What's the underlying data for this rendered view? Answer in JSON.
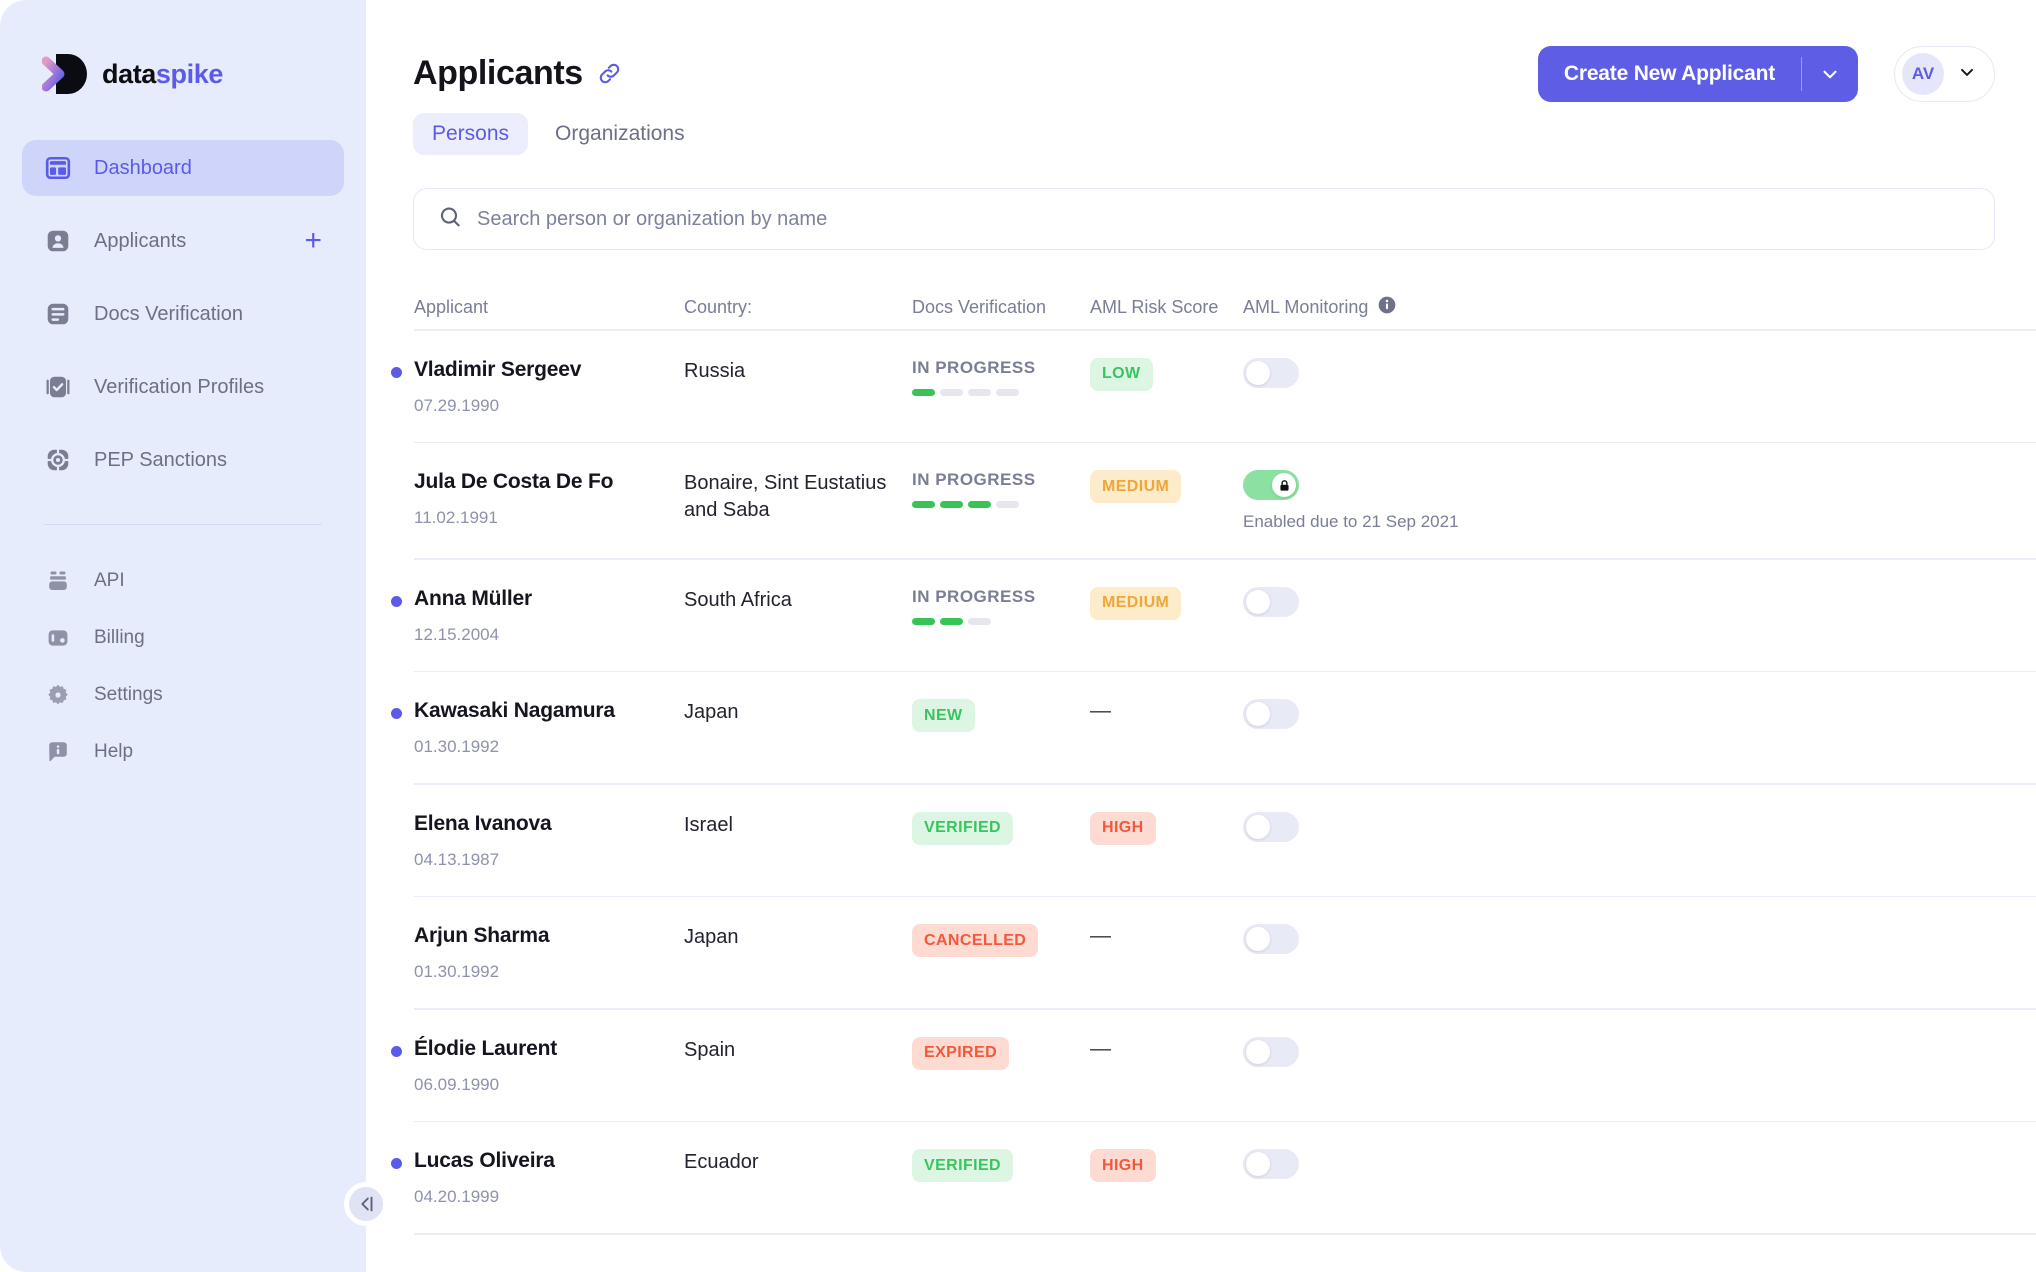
{
  "brand": {
    "name_part1": "data",
    "name_part2": "spike"
  },
  "sidebar": {
    "primary": [
      {
        "label": "Dashboard",
        "icon": "dashboard-icon",
        "active": true
      },
      {
        "label": "Applicants",
        "icon": "user-icon",
        "active": false,
        "action": "+"
      },
      {
        "label": "Docs Verification",
        "icon": "document-icon",
        "active": false
      },
      {
        "label": "Verification Profiles",
        "icon": "check-badge-icon",
        "active": false
      },
      {
        "label": "PEP Sanctions",
        "icon": "target-icon",
        "active": false
      }
    ],
    "secondary": [
      {
        "label": "API",
        "icon": "server-icon"
      },
      {
        "label": "Billing",
        "icon": "wallet-icon"
      },
      {
        "label": "Settings",
        "icon": "gear-icon"
      },
      {
        "label": "Help",
        "icon": "info-bubble-icon"
      }
    ],
    "collapse_label": "collapse-sidebar"
  },
  "header": {
    "title": "Applicants",
    "link_icon": "link-icon",
    "tabs": [
      {
        "label": "Persons",
        "active": true
      },
      {
        "label": "Organizations",
        "active": false
      }
    ],
    "create_button": "Create New Applicant",
    "create_caret": "chevron-down-icon",
    "avatar_initials": "AV",
    "avatar_caret": "chevron-down-icon"
  },
  "search": {
    "value": "",
    "placeholder": "Search person or organization by name",
    "icon": "search-icon"
  },
  "table": {
    "columns": [
      "Applicant",
      "Country:",
      "Docs Verification",
      "AML Risk Score",
      "AML Monitoring"
    ],
    "aml_monitoring_info_icon": "info-icon",
    "rows": [
      {
        "dot": true,
        "name": "Vladimir Sergeev",
        "dob": "07.29.1990",
        "country": "Russia",
        "docs": {
          "kind": "progress",
          "label": "IN PROGRESS",
          "segments": 4,
          "filled": 1
        },
        "aml_risk": {
          "kind": "chip",
          "label": "LOW",
          "tone": "green"
        },
        "monitoring": {
          "on": false,
          "locked": false,
          "note": ""
        }
      },
      {
        "dot": false,
        "name": "Jula De Costa De Fo",
        "dob": "11.02.1991",
        "country": "Bonaire, Sint Eustatius and Saba",
        "docs": {
          "kind": "progress",
          "label": "IN PROGRESS",
          "segments": 4,
          "filled": 3
        },
        "aml_risk": {
          "kind": "chip",
          "label": "MEDIUM",
          "tone": "amber"
        },
        "monitoring": {
          "on": true,
          "locked": true,
          "note": "Enabled due to 21 Sep 2021"
        }
      },
      {
        "dot": true,
        "name": "Anna Müller",
        "dob": "12.15.2004",
        "country": "South Africa",
        "docs": {
          "kind": "progress",
          "label": "IN PROGRESS",
          "segments": 3,
          "filled": 2
        },
        "aml_risk": {
          "kind": "chip",
          "label": "MEDIUM",
          "tone": "amber"
        },
        "monitoring": {
          "on": false,
          "locked": false,
          "note": ""
        }
      },
      {
        "dot": true,
        "name": "Kawasaki Nagamura",
        "dob": "01.30.1992",
        "country": "Japan",
        "docs": {
          "kind": "chip",
          "label": "NEW",
          "tone": "green"
        },
        "aml_risk": {
          "kind": "dash",
          "label": "—"
        },
        "monitoring": {
          "on": false,
          "locked": false,
          "note": ""
        }
      },
      {
        "dot": false,
        "name": "Elena Ivanova",
        "dob": "04.13.1987",
        "country": "Israel",
        "docs": {
          "kind": "chip",
          "label": "VERIFIED",
          "tone": "green"
        },
        "aml_risk": {
          "kind": "chip",
          "label": "HIGH",
          "tone": "red"
        },
        "monitoring": {
          "on": false,
          "locked": false,
          "note": ""
        }
      },
      {
        "dot": false,
        "name": "Arjun Sharma",
        "dob": "01.30.1992",
        "country": "Japan",
        "docs": {
          "kind": "chip",
          "label": "CANCELLED",
          "tone": "red"
        },
        "aml_risk": {
          "kind": "dash",
          "label": "—"
        },
        "monitoring": {
          "on": false,
          "locked": false,
          "note": ""
        }
      },
      {
        "dot": true,
        "name": "Élodie Laurent",
        "dob": "06.09.1990",
        "country": "Spain",
        "docs": {
          "kind": "chip",
          "label": "EXPIRED",
          "tone": "red"
        },
        "aml_risk": {
          "kind": "dash",
          "label": "—"
        },
        "monitoring": {
          "on": false,
          "locked": false,
          "note": ""
        }
      },
      {
        "dot": true,
        "name": "Lucas Oliveira",
        "dob": "04.20.1999",
        "country": "Ecuador",
        "docs": {
          "kind": "chip",
          "label": "VERIFIED",
          "tone": "green"
        },
        "aml_risk": {
          "kind": "chip",
          "label": "HIGH",
          "tone": "red"
        },
        "monitoring": {
          "on": false,
          "locked": false,
          "note": ""
        }
      }
    ]
  },
  "colors": {
    "accent": "#5b5be8",
    "sidebar_bg": "#e6ecfb",
    "active_nav_bg": "#cfd4fb",
    "green": "#3ac45f",
    "amber": "#efa63b",
    "red": "#f2583c",
    "toggle_on": "#8ce0a1"
  }
}
